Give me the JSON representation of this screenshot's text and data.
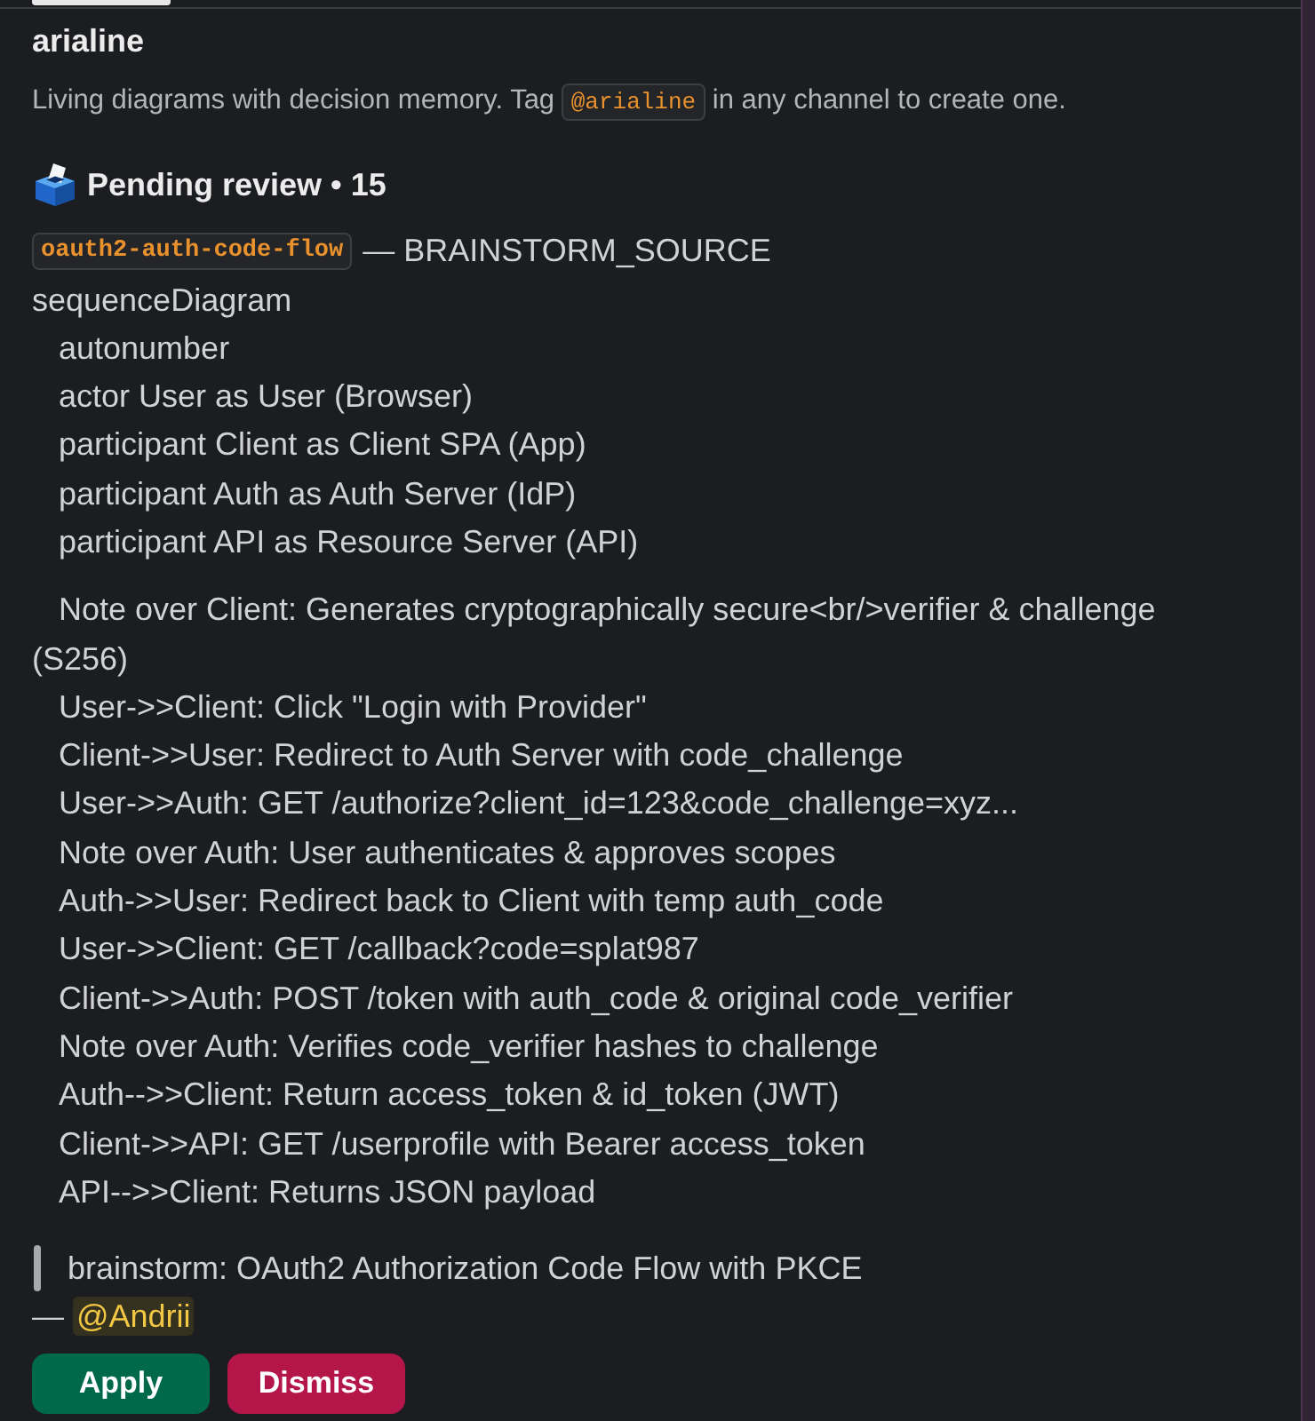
{
  "app": {
    "name": "arialine",
    "description": {
      "before": "Living diagrams with decision memory. Tag",
      "code": "@arialine",
      "after": "in any channel to create one."
    }
  },
  "pending": {
    "label": "Pending review • 15"
  },
  "item": {
    "slug": "oauth2-auth-code-flow",
    "source": "— BRAINSTORM_SOURCE"
  },
  "diagram": {
    "header": "sequenceDiagram",
    "blocks": [
      [
        "autonumber",
        "actor User as User (Browser)",
        "participant Client as Client SPA (App)",
        "participant Auth as Auth Server (IdP)",
        "participant API as Resource Server (API)"
      ],
      [
        "Note over Client: Generates cryptographically secure<br/>verifier & challenge (S256)",
        "User->>Client: Click \"Login with Provider\"",
        "Client->>User: Redirect to Auth Server with code_challenge",
        "User->>Auth: GET /authorize?client_id=123&code_challenge=xyz...",
        "Note over Auth: User authenticates & approves scopes",
        "Auth->>User: Redirect back to Client with temp auth_code",
        "User->>Client: GET /callback?code=splat987",
        "Client->>Auth: POST /token with auth_code & original code_verifier",
        "Note over Auth: Verifies code_verifier hashes to challenge",
        "Auth-->>Client: Return access_token & id_token (JWT)",
        "Client->>API: GET /userprofile with Bearer access_token",
        "API-->>Client: Returns JSON payload"
      ]
    ]
  },
  "quote": "brainstorm: OAuth2 Authorization Code Flow with PKCE",
  "attribution": {
    "dash": "—",
    "mention": "@Andrii"
  },
  "buttons": [
    {
      "label": "Apply",
      "kind": "primary"
    },
    {
      "label": "Dismiss",
      "kind": "danger"
    }
  ]
}
